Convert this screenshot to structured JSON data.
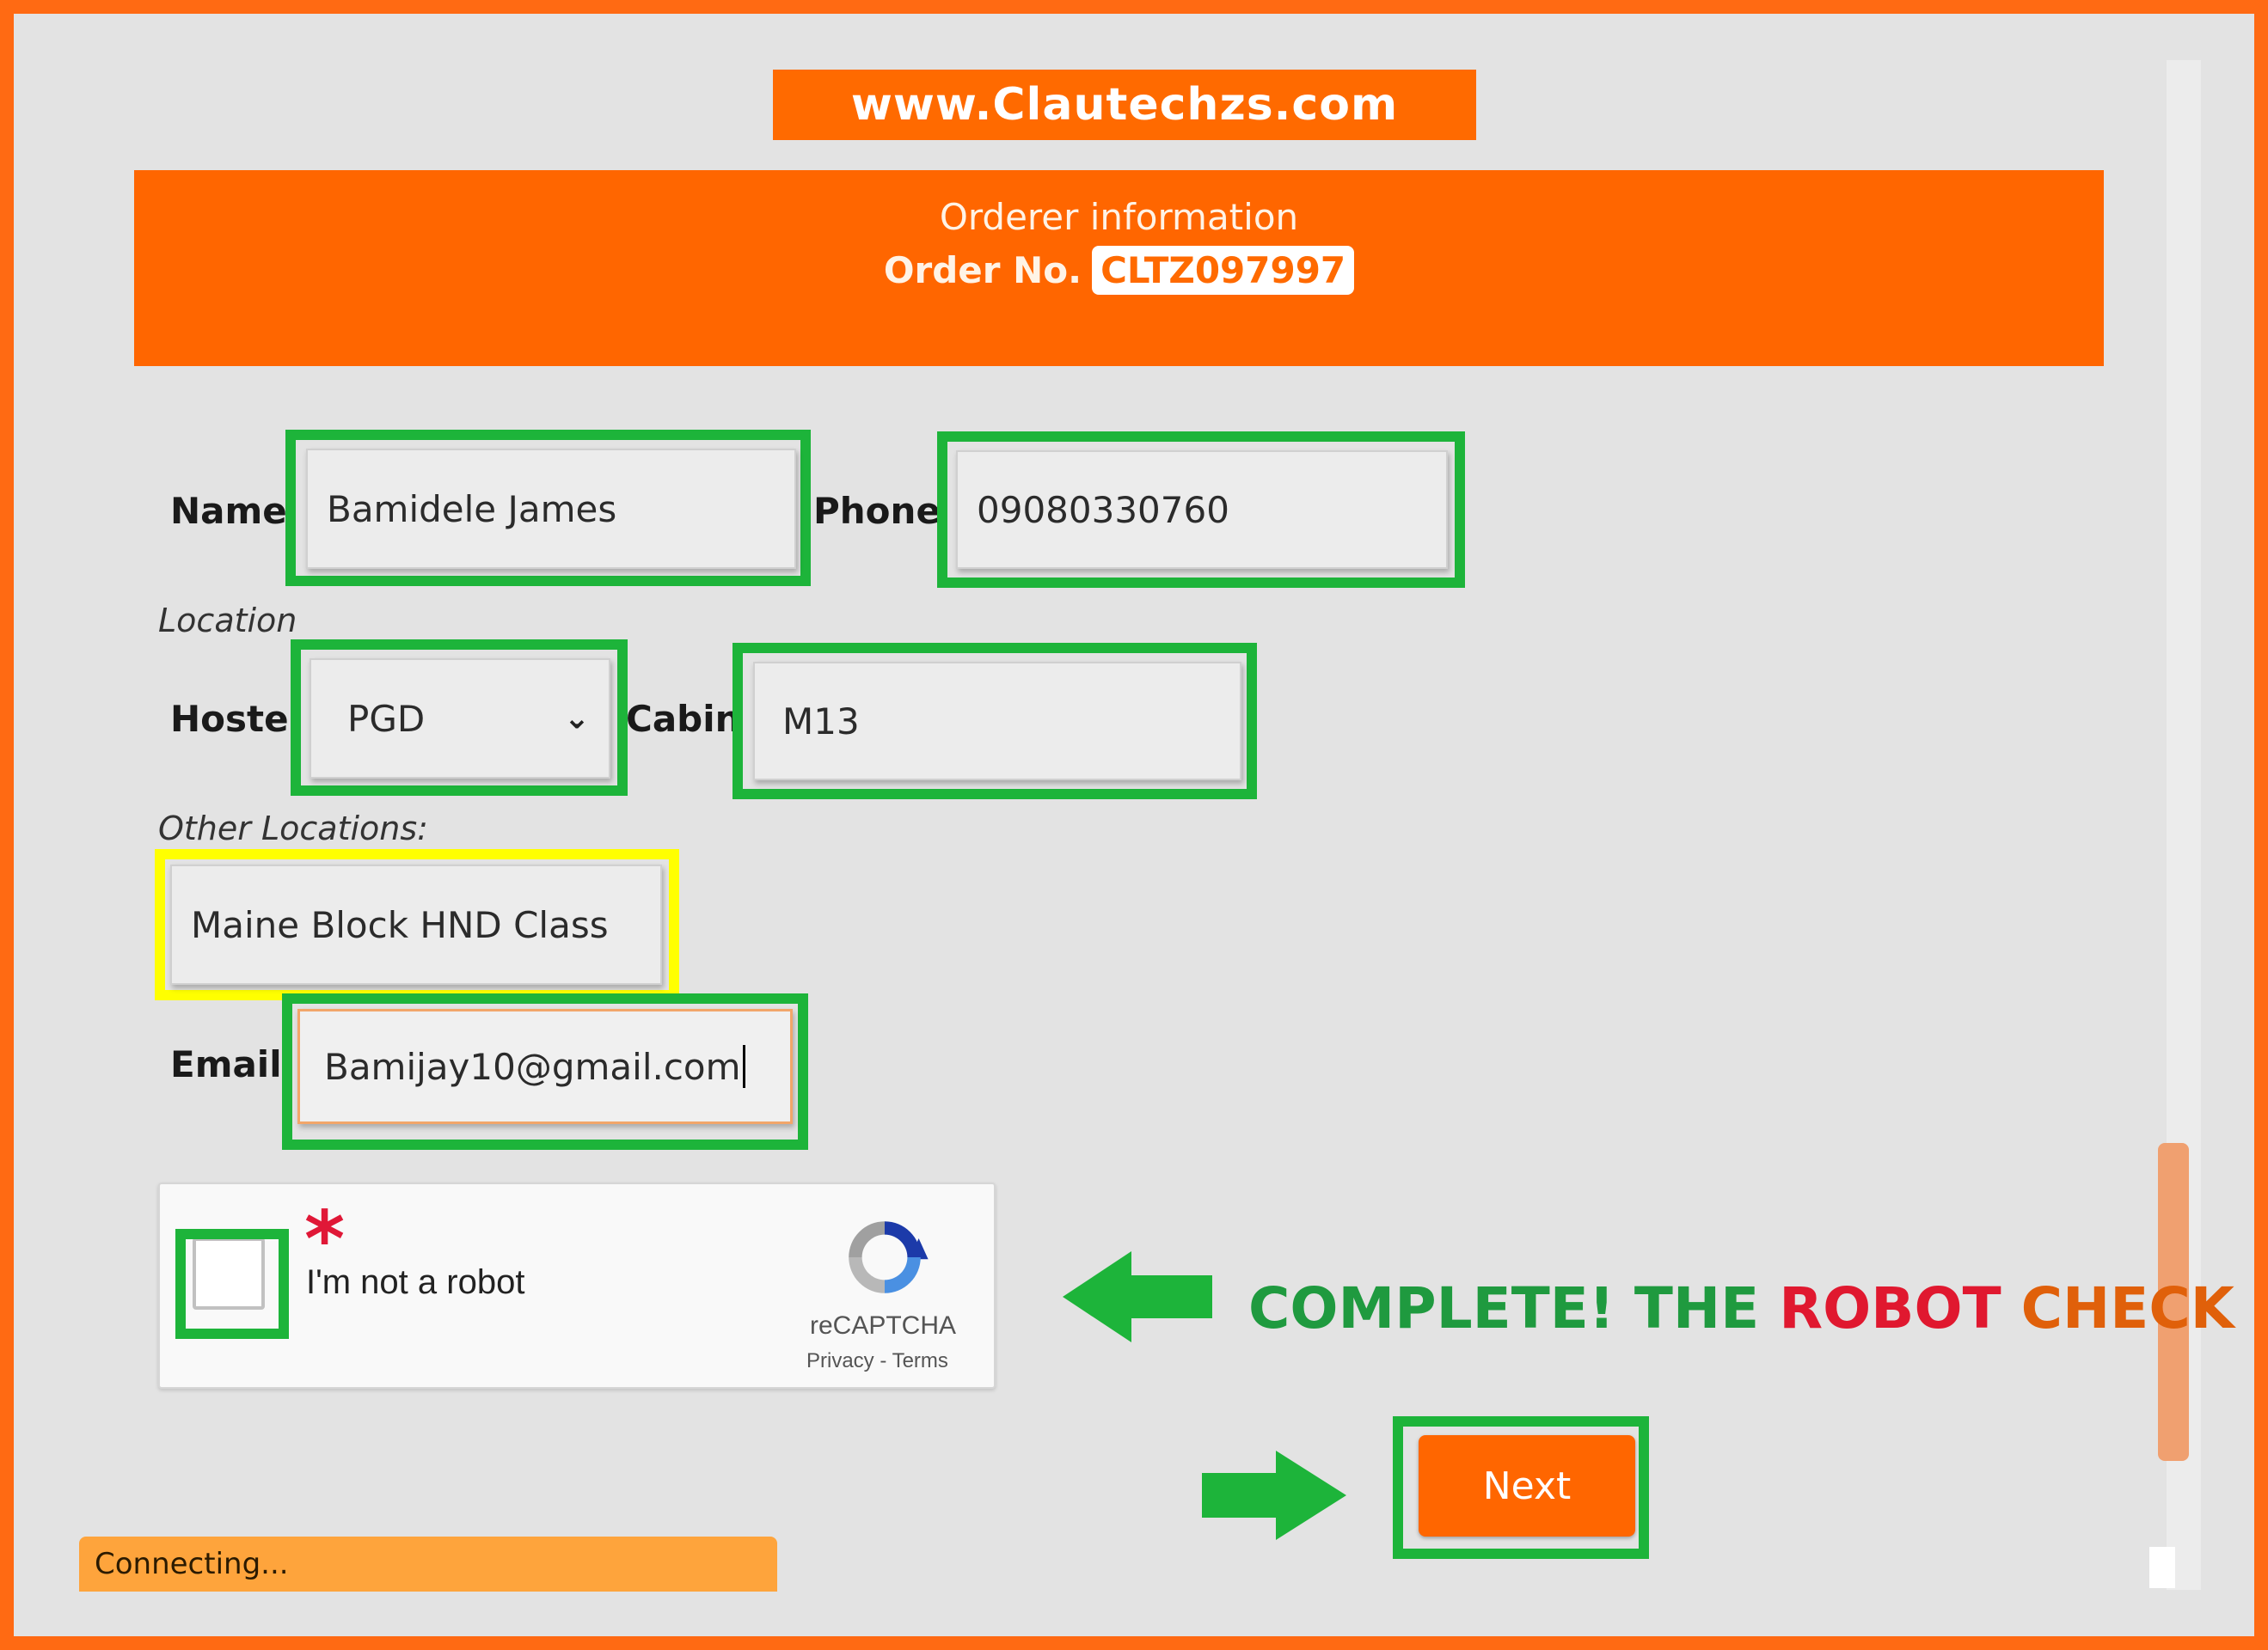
{
  "banner": {
    "text": "www.Clautechzs.com"
  },
  "header": {
    "title": "Orderer information",
    "order_label": "Order No.",
    "order_value": "CLTZ097997"
  },
  "form": {
    "name_label": "Name",
    "name_value": "Bamidele James",
    "phone_label": "Phone",
    "phone_value": "09080330760",
    "location_label": "Location",
    "hostel_label": "Hostel",
    "hostel_value": "PGD",
    "cabin_label": "Cabin",
    "cabin_value": "M13",
    "other_locations_label": "Other Locations:",
    "other_locations_value": "Maine Block HND Class",
    "email_label": "Email",
    "email_value": "Bamijay10@gmail.com"
  },
  "captcha": {
    "asterisk": "*",
    "text": "I'm not a robot",
    "brand": "reCAPTCHA",
    "links": "Privacy - Terms"
  },
  "callout": {
    "part1": "COMPLETE! THE ",
    "part2": "ROBOT",
    "part3": " CHECK",
    "colors": {
      "part1": "#1f9a3f",
      "part2": "#e0182f",
      "part3": "#e0600a"
    }
  },
  "next_button": {
    "label": "Next"
  },
  "status": {
    "text": "Connecting..."
  },
  "colors": {
    "brand": "#ff6600",
    "highlight_green": "#1db43a",
    "highlight_yellow": "#ffff00"
  }
}
